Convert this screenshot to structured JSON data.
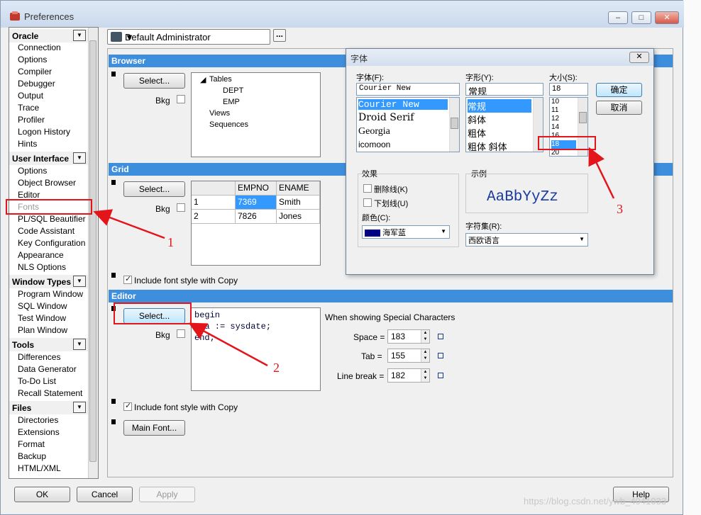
{
  "window": {
    "title": "Preferences",
    "controls": {
      "minimize": "–",
      "maximize": "□",
      "close": "✕"
    }
  },
  "sidebar": {
    "groups": [
      {
        "label": "Oracle",
        "items": [
          "Connection",
          "Options",
          "Compiler",
          "Debugger",
          "Output",
          "Trace",
          "Profiler",
          "Logon History",
          "Hints"
        ]
      },
      {
        "label": "User Interface",
        "items": [
          "Options",
          "Object Browser",
          "Editor",
          "Fonts",
          "PL/SQL Beautifier",
          "Code Assistant",
          "Key Configuration",
          "Appearance",
          "NLS Options"
        ]
      },
      {
        "label": "Window Types",
        "items": [
          "Program Window",
          "SQL Window",
          "Test Window",
          "Plan Window"
        ]
      },
      {
        "label": "Tools",
        "items": [
          "Differences",
          "Data Generator",
          "To-Do List",
          "Recall Statement"
        ]
      },
      {
        "label": "Files",
        "items": [
          "Directories",
          "Extensions",
          "Format",
          "Backup",
          "HTML/XML"
        ]
      }
    ],
    "selected": "Fonts"
  },
  "user_combo": {
    "value": "Default Administrator",
    "more": "..."
  },
  "browser": {
    "title": "Browser",
    "select_label": "Select...",
    "bkg_label": "Bkg",
    "tree": {
      "root": "Tables",
      "children": [
        "DEPT",
        "EMP"
      ],
      "others": [
        "Views",
        "Sequences"
      ]
    }
  },
  "grid": {
    "title": "Grid",
    "select_label": "Select...",
    "bkg_label": "Bkg",
    "headers": [
      "",
      "EMPNO",
      "ENAME"
    ],
    "rows": [
      [
        "1",
        "7369",
        "Smith"
      ],
      [
        "2",
        "7826",
        "Jones"
      ]
    ],
    "include_style_label": "Include font style with Copy"
  },
  "editor": {
    "title": "Editor",
    "select_label": "Select...",
    "bkg_label": "Bkg",
    "code_lines": [
      "begin",
      "  a := sysdate;",
      "end;"
    ],
    "special_title": "When showing Special Characters",
    "space_label": "Space =",
    "space_value": "183",
    "tab_label": "Tab =",
    "tab_value": "155",
    "linebreak_label": "Line break =",
    "linebreak_value": "182",
    "include_style_label": "Include font style with Copy",
    "main_font_label": "Main Font..."
  },
  "footer": {
    "ok": "OK",
    "cancel": "Cancel",
    "apply": "Apply",
    "help": "Help"
  },
  "font_dialog": {
    "title": "字体",
    "close": "✕",
    "font_label": "字体(F):",
    "font_value": "Courier New",
    "fonts": [
      "Courier New",
      "Droid Serif",
      "Georgia",
      "icomoon"
    ],
    "style_label": "字形(Y):",
    "style_value": "常规",
    "styles": [
      "常规",
      "斜体",
      "粗体",
      "粗体 斜体"
    ],
    "size_label": "大小(S):",
    "size_value": "18",
    "sizes": [
      "10",
      "11",
      "12",
      "14",
      "16",
      "18",
      "20"
    ],
    "ok": "确定",
    "cancel": "取消",
    "effects_label": "效果",
    "strike_label": "删除线(K)",
    "underline_label": "下划线(U)",
    "color_label": "颜色(C):",
    "color_value": "海军蓝",
    "sample_label": "示例",
    "sample_text": "AaBbYyZz",
    "charset_label": "字符集(R):",
    "charset_value": "西欧语言"
  },
  "annotations": {
    "one": "1",
    "two": "2",
    "three": "3",
    "color": "#e4141b"
  },
  "watermark": "https://blog.csdn.net/ywb_4041033",
  "colors": {
    "section_header": "#3e8ede",
    "selection": "#3399ff",
    "navy": "#000080"
  }
}
